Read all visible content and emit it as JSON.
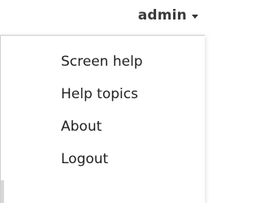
{
  "user_menu": {
    "username": "admin",
    "caret_icon": "caret-down-icon"
  },
  "dropdown": {
    "items": [
      {
        "label": "Screen help"
      },
      {
        "label": "Help topics"
      },
      {
        "label": "About"
      },
      {
        "label": "Logout"
      }
    ]
  }
}
